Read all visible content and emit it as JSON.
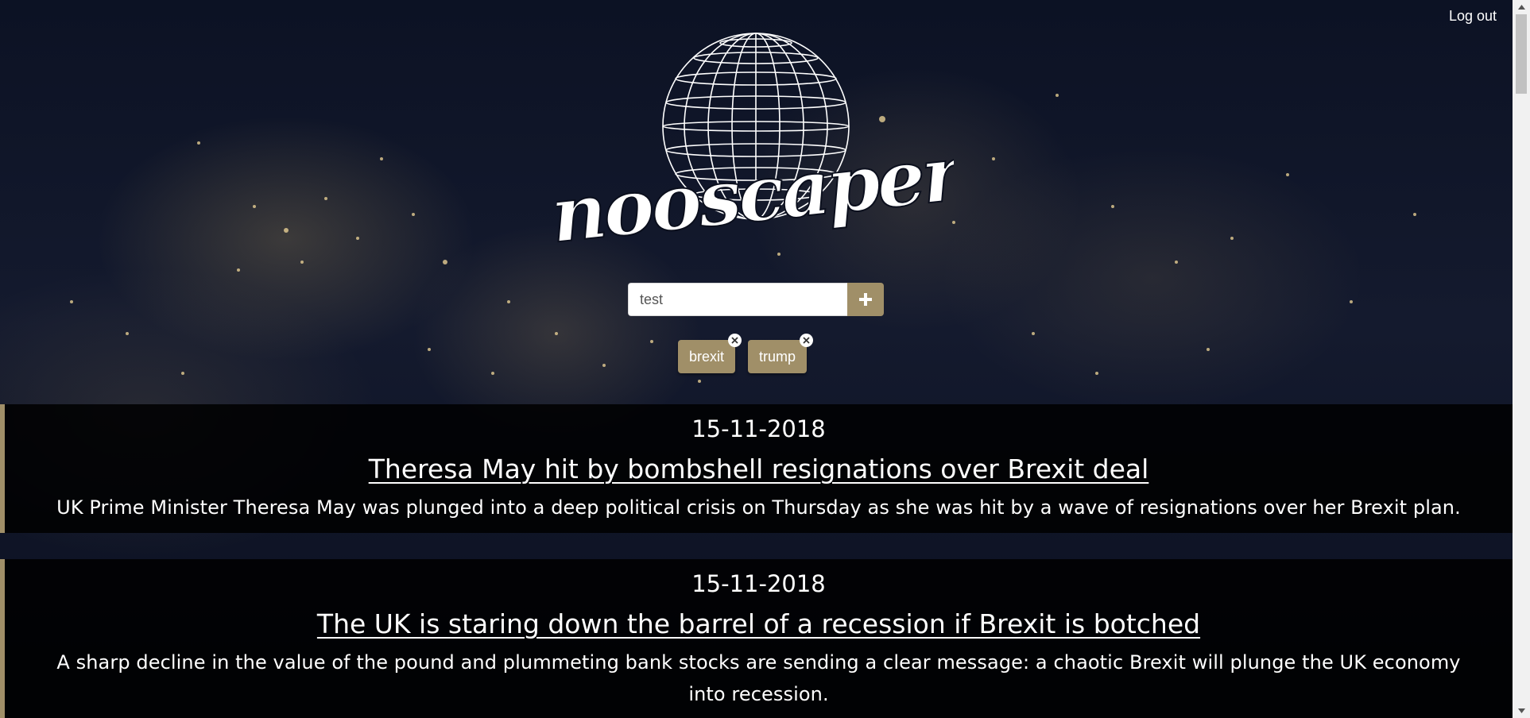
{
  "header": {
    "logout_label": "Log out",
    "logo_text": "nooscaper"
  },
  "search": {
    "value": "test",
    "add_icon": "plus-icon"
  },
  "tags": [
    {
      "label": "brexit",
      "remove_icon": "close-icon"
    },
    {
      "label": "trump",
      "remove_icon": "close-icon"
    }
  ],
  "articles": [
    {
      "date": "15-11-2018",
      "title": "Theresa May hit by bombshell resignations over Brexit deal",
      "summary": "UK Prime Minister Theresa May was plunged into a deep political crisis on Thursday as she was hit by a wave of resignations over her Brexit plan."
    },
    {
      "date": "15-11-2018",
      "title": "The UK is staring down the barrel of a recession if Brexit is botched",
      "summary": "A sharp decline in the value of the pound and plummeting bank stocks are sending a clear message: a chaotic Brexit will plunge the UK economy into recession."
    }
  ],
  "colors": {
    "accent": "#a08f68",
    "article_background": "#000000",
    "text": "#ffffff"
  }
}
